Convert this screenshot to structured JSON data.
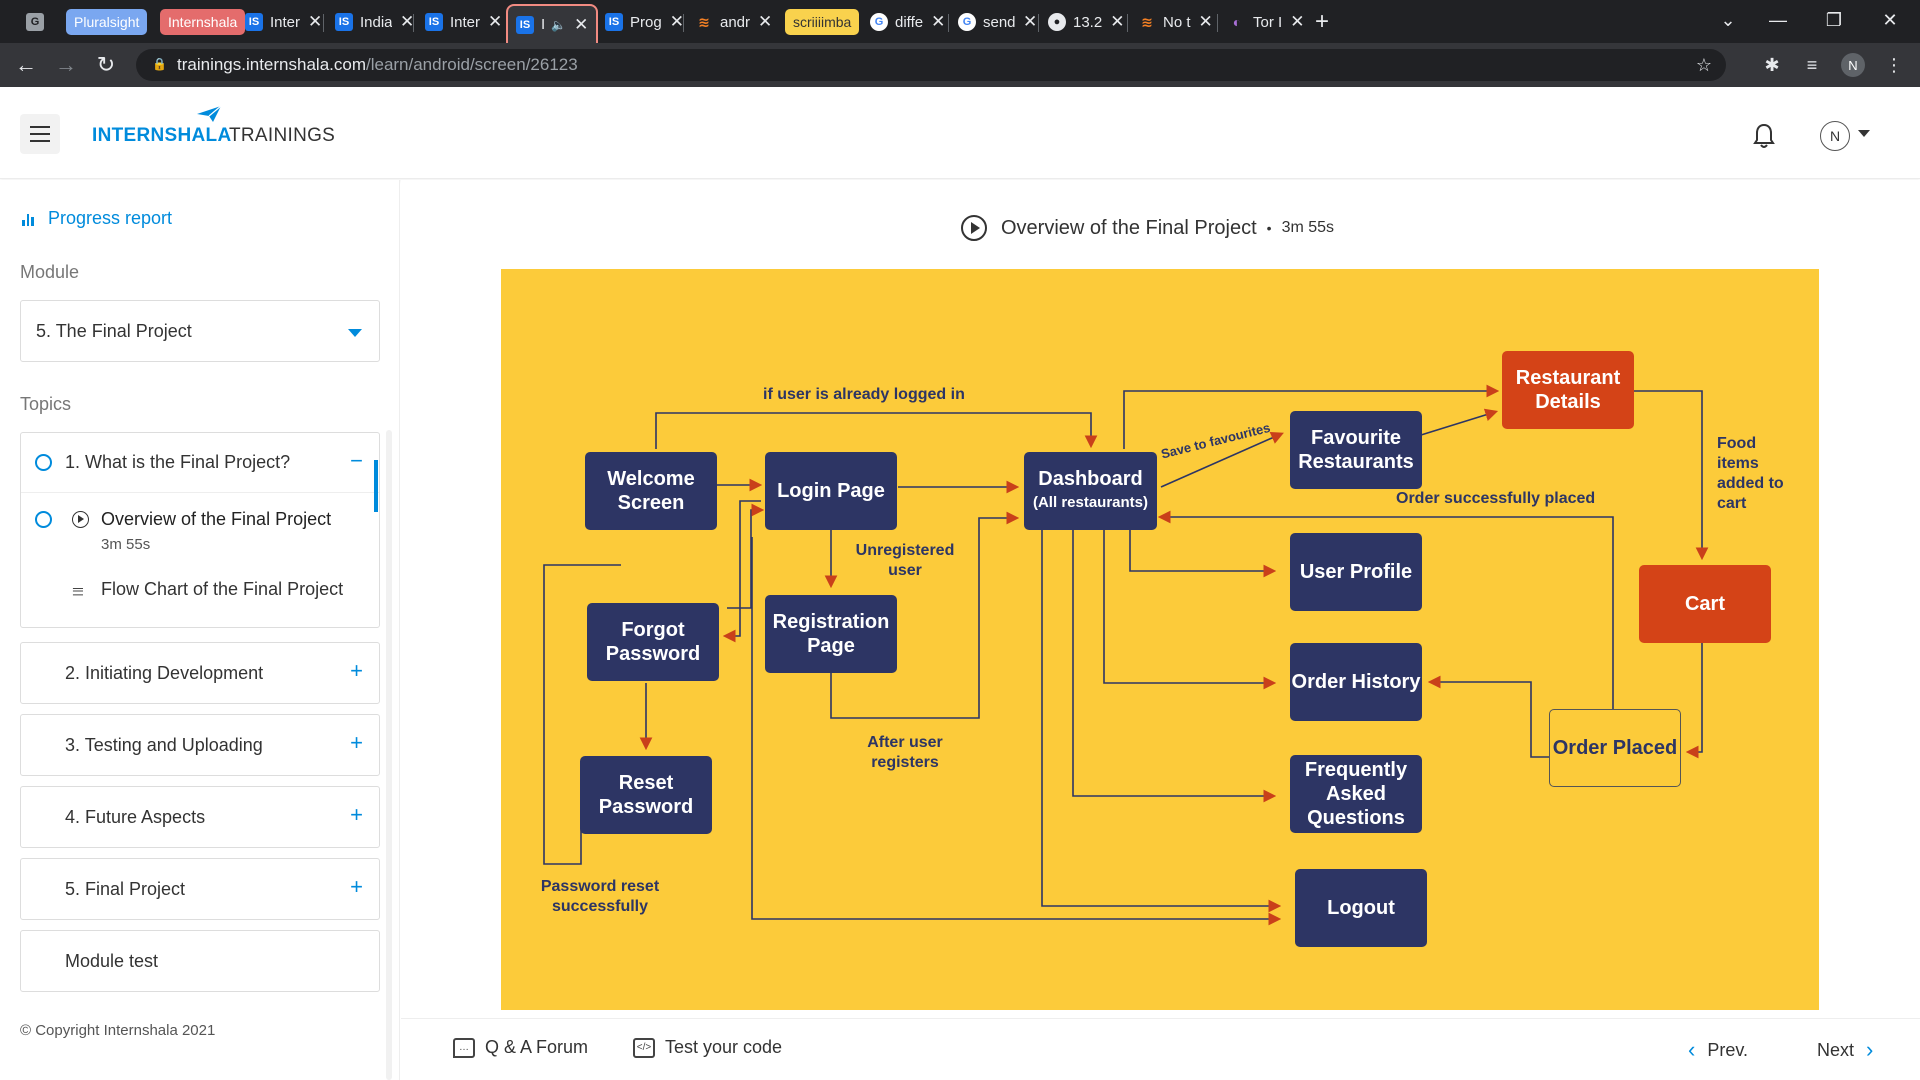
{
  "browser": {
    "tabs": [
      {
        "title": "G",
        "type": "favicon"
      },
      {
        "title": "Pluralsight",
        "type": "pill"
      },
      {
        "title": "Internshala",
        "type": "pill"
      },
      {
        "title": "Inter",
        "type": "tab"
      },
      {
        "title": "India",
        "type": "tab"
      },
      {
        "title": "Inter",
        "type": "tab"
      },
      {
        "title": "I",
        "type": "active"
      },
      {
        "title": "Prog",
        "type": "tab"
      },
      {
        "title": "andr",
        "type": "tab"
      },
      {
        "title": "scriiiimba",
        "type": "pill"
      },
      {
        "title": "diffe",
        "type": "tab"
      },
      {
        "title": "send",
        "type": "tab"
      },
      {
        "title": "13.2",
        "type": "tab"
      },
      {
        "title": "No t",
        "type": "tab"
      },
      {
        "title": "Tor I",
        "type": "tab"
      }
    ],
    "new_tab": "+",
    "url_domain": "trainings.internshala.com",
    "url_path": "/learn/android/screen/26123",
    "profile_initial": "N"
  },
  "header": {
    "brand_bold": "INTERNSHALA",
    "brand_light": "TRAININGS",
    "user_initial": "N"
  },
  "sidebar": {
    "progress_label": "Progress report",
    "module_label": "Module",
    "module_selected": "5. The Final Project",
    "topics_label": "Topics",
    "topics": [
      {
        "title": "1. What is the Final Project?",
        "sign": "−"
      },
      {
        "title": "2. Initiating Development",
        "sign": "+"
      },
      {
        "title": "3. Testing and Uploading",
        "sign": "+"
      },
      {
        "title": "4. Future Aspects",
        "sign": "+"
      },
      {
        "title": "5. Final Project",
        "sign": "+"
      },
      {
        "title": "Module test",
        "sign": ""
      }
    ],
    "subitems": [
      {
        "title": "Overview of the Final Project",
        "duration": "3m 55s"
      },
      {
        "title": "Flow Chart of the Final Project"
      }
    ],
    "copyright": "© Copyright Internshala 2021"
  },
  "video": {
    "title": "Overview of the Final Project",
    "separator": "•",
    "duration": "3m 55s"
  },
  "flowchart": {
    "nodes": {
      "welcome": "Welcome Screen",
      "login": "Login Page",
      "dashboard": "Dashboard",
      "dashboard_sub": "(All restaurants)",
      "restaurant_details": "Restaurant Details",
      "favourite": "Favourite Restaurants",
      "user_profile": "User Profile",
      "order_history": "Order History",
      "faq": "Frequently Asked Questions",
      "logout": "Logout",
      "cart": "Cart",
      "order_placed": "Order Placed",
      "forgot": "Forgot Password",
      "reset": "Reset Password",
      "registration": "Registration Page"
    },
    "labels": {
      "logged_in": "if user is already logged in",
      "save_fav": "Save to favourites",
      "unregistered": "Unregistered user",
      "after_register": "After user registers",
      "reset_success": "Password reset successfully",
      "order_success": "Order successfully placed",
      "food_items": "Food items added to cart"
    }
  },
  "footer": {
    "qa": "Q & A Forum",
    "test": "Test your code",
    "prev": "Prev.",
    "next": "Next"
  },
  "colors": {
    "accent": "#008bdc",
    "flow_bg": "#fccb3a",
    "node_navy": "#2d3564",
    "node_red": "#d44317",
    "arrow": "#c9401a"
  }
}
